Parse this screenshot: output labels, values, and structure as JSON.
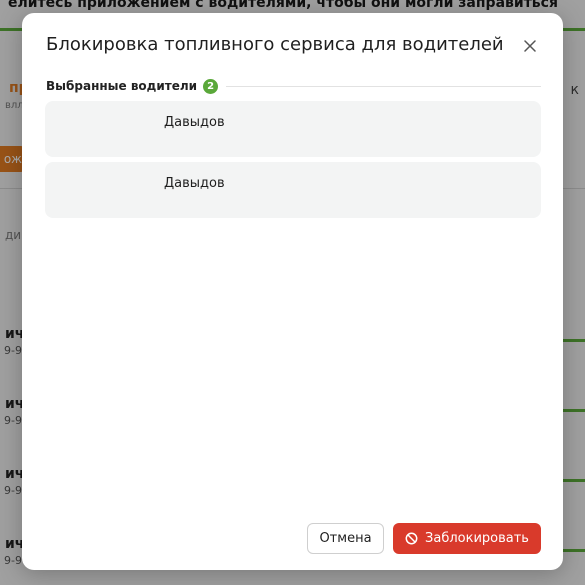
{
  "background": {
    "top_text": "елитесь приложением с водителями, чтобы они могли заправиться",
    "orange_text": "пр",
    "small_text": "влл",
    "orange_button_text": "ож",
    "column_text": "ди",
    "rows": [
      {
        "name": "ич",
        "phone": "9-9"
      },
      {
        "name": "ич",
        "phone": "9-9"
      },
      {
        "name": "ич",
        "phone": "9-9"
      },
      {
        "name": "ич",
        "phone": "9-9"
      }
    ],
    "right_glyph": "к"
  },
  "modal": {
    "title": "Блокировка топливного сервиса для водителей",
    "close_icon": "close-icon",
    "section_label": "Выбранные водители",
    "selected_count": "2",
    "drivers": [
      {
        "name": "Давыдов"
      },
      {
        "name": "Давыдов"
      }
    ],
    "cancel_label": "Отмена",
    "block_label": "Заблокировать",
    "block_icon": "ban-icon"
  },
  "colors": {
    "accent_green": "#5aa83a",
    "danger_red": "#d93a2b",
    "bg_orange": "#e07b22"
  }
}
